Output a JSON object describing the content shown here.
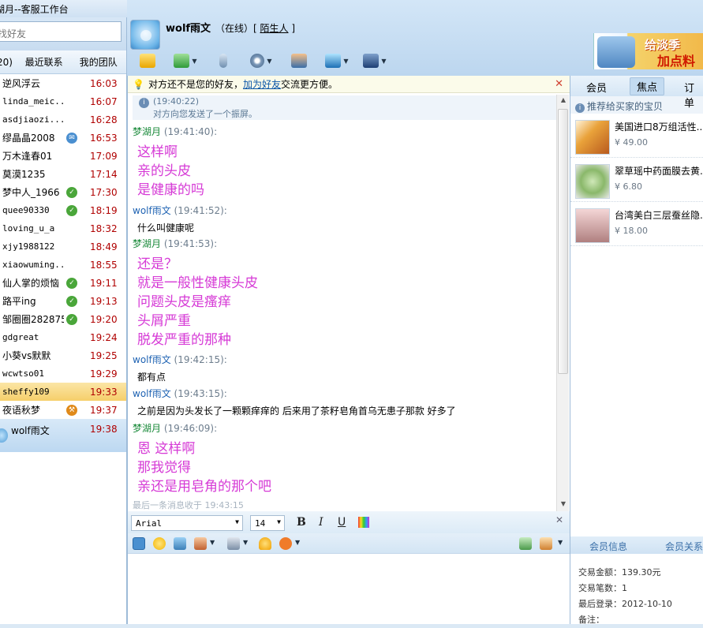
{
  "window": {
    "title": "湖月--客服工作台"
  },
  "left": {
    "search_placeholder": "找好友",
    "tabs": [
      "20)",
      "最近联系",
      "我的团队"
    ],
    "contacts": [
      {
        "name": "逆风浮云",
        "time": "16:03",
        "badge": ""
      },
      {
        "name": "linda_meic...",
        "time": "16:07",
        "badge": "",
        "mono": true
      },
      {
        "name": "asdjiaozi...",
        "time": "16:28",
        "badge": "",
        "mono": true
      },
      {
        "name": "缪晶晶2008",
        "time": "16:53",
        "badge": "mail"
      },
      {
        "name": "万木逢春01",
        "time": "17:09",
        "badge": ""
      },
      {
        "name": "莫漠1235",
        "time": "17:14",
        "badge": ""
      },
      {
        "name": "梦中人_1966",
        "time": "17:30",
        "badge": "check"
      },
      {
        "name": "quee90330",
        "time": "18:19",
        "badge": "check",
        "mono": true
      },
      {
        "name": "loving_u_a",
        "time": "18:32",
        "badge": "",
        "mono": true
      },
      {
        "name": "xjy1988122",
        "time": "18:49",
        "badge": "",
        "mono": true
      },
      {
        "name": "xiaowuming...",
        "time": "18:55",
        "badge": "",
        "mono": true
      },
      {
        "name": "仙人掌的烦恼",
        "time": "19:11",
        "badge": "check"
      },
      {
        "name": "路平ing",
        "time": "19:13",
        "badge": "check"
      },
      {
        "name": "邹圈圈282875",
        "time": "19:20",
        "badge": "check"
      },
      {
        "name": "gdgreat",
        "time": "19:24",
        "badge": "",
        "mono": true
      },
      {
        "name": "小葵vs默默",
        "time": "19:25",
        "badge": ""
      },
      {
        "name": "wcwtso01",
        "time": "19:29",
        "badge": "",
        "mono": true
      },
      {
        "name": "sheffy109",
        "time": "19:33",
        "badge": "",
        "mono": true,
        "highlight": true
      },
      {
        "name": "夜语秋梦",
        "time": "19:37",
        "badge": "tool"
      },
      {
        "name": "wolf雨文",
        "time": "19:38",
        "badge": "",
        "selected": true
      }
    ]
  },
  "header": {
    "username": "wolf雨文",
    "status_prefix": "（在线）[",
    "status_link": "陌生人",
    "status_suffix": "]",
    "ad_text1": "给淡季",
    "ad_text2": "加点料"
  },
  "chat": {
    "notice_pre": "对方还不是您的好友，",
    "notice_link": "加为好友",
    "notice_post": "交流更方便。",
    "notice_close": "✕",
    "sys_time": "(19:40:22)",
    "sys_text": "对方向您发送了一个振屏。",
    "messages": [
      {
        "who": "them",
        "name": "梦湖月",
        "ts": "(19:41:40):",
        "lines": [
          "这样啊",
          "亲的头皮",
          "是健康的吗"
        ]
      },
      {
        "who": "me",
        "name": "wolf雨文",
        "ts": "(19:41:52):",
        "lines": [
          "什么叫健康呢"
        ]
      },
      {
        "who": "them",
        "name": "梦湖月",
        "ts": "(19:41:53):",
        "lines": [
          "还是？",
          "就是一般性健康头皮",
          "问题头皮是瘙痒",
          "头屑严重",
          "脱发严重的那种"
        ]
      },
      {
        "who": "me",
        "name": "wolf雨文",
        "ts": "(19:42:15):",
        "lines": [
          "都有点"
        ]
      },
      {
        "who": "me",
        "name": "wolf雨文",
        "ts": "(19:43:15):",
        "lines": [
          "之前是因为头发长了一颗颗痒痒的  后来用了茶籽皂角首乌无患子那款 好多了"
        ]
      },
      {
        "who": "them",
        "name": "梦湖月",
        "ts": "(19:46:09):",
        "lines": [
          "恩 这样啊",
          "那我觉得",
          "亲还是用皂角的那个吧"
        ]
      }
    ],
    "last_msg": "最后一条消息收于 19:43:15"
  },
  "input": {
    "font": "Arial",
    "size": "14",
    "bold": "B",
    "italic": "I",
    "underline": "U",
    "close": "✕"
  },
  "right": {
    "tabs": [
      "会员",
      "焦点",
      "订单"
    ],
    "recommend": "推荐给买家的宝贝",
    "products": [
      {
        "name": "美国进口8万组活性...",
        "price": "¥ 49.00"
      },
      {
        "name": "翠草瑶中药面膜去黄...",
        "price": "¥ 6.80"
      },
      {
        "name": "台湾美白三层蚕丝隐...",
        "price": "¥ 18.00"
      }
    ],
    "member_tabs": [
      "会员信息",
      "会员关系"
    ],
    "member_info": [
      "交易金额：139.30元",
      "交易笔数：1",
      "最后登录：2012-10-10",
      "备注："
    ]
  },
  "colors": {
    "them_text": "#d63ad6",
    "time_red": "#b00000",
    "check_green": "#4aa63a"
  }
}
